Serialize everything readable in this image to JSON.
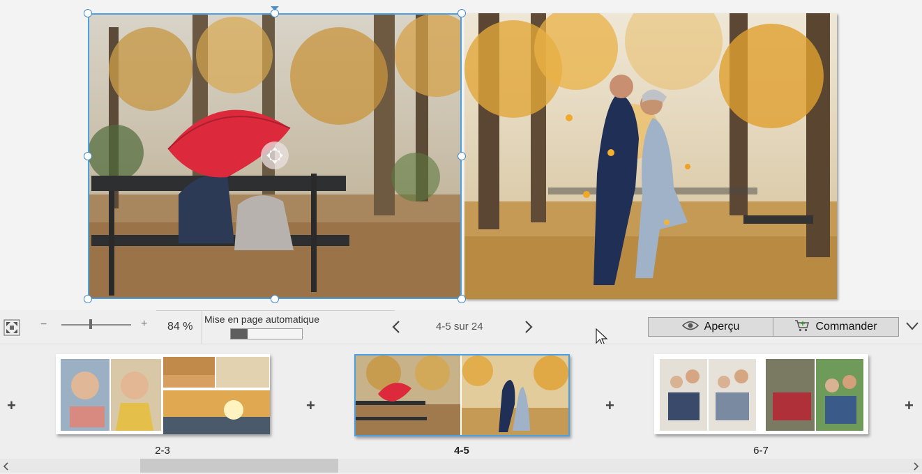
{
  "toolbar": {
    "zoom_value": "84 %",
    "zoom_minus": "−",
    "zoom_plus": "+",
    "auto_layout_label": "Mise en page automatique",
    "page_info": "4-5 sur 24",
    "preview_label": "Aperçu",
    "order_label": "Commander"
  },
  "thumbnails": [
    {
      "label": "2-3",
      "selected": false
    },
    {
      "label": "4-5",
      "selected": true
    },
    {
      "label": "6-7",
      "selected": false
    }
  ],
  "plus_symbol": "+",
  "colors": {
    "selection": "#4aa0e0",
    "accent": "#4aa0e0"
  }
}
